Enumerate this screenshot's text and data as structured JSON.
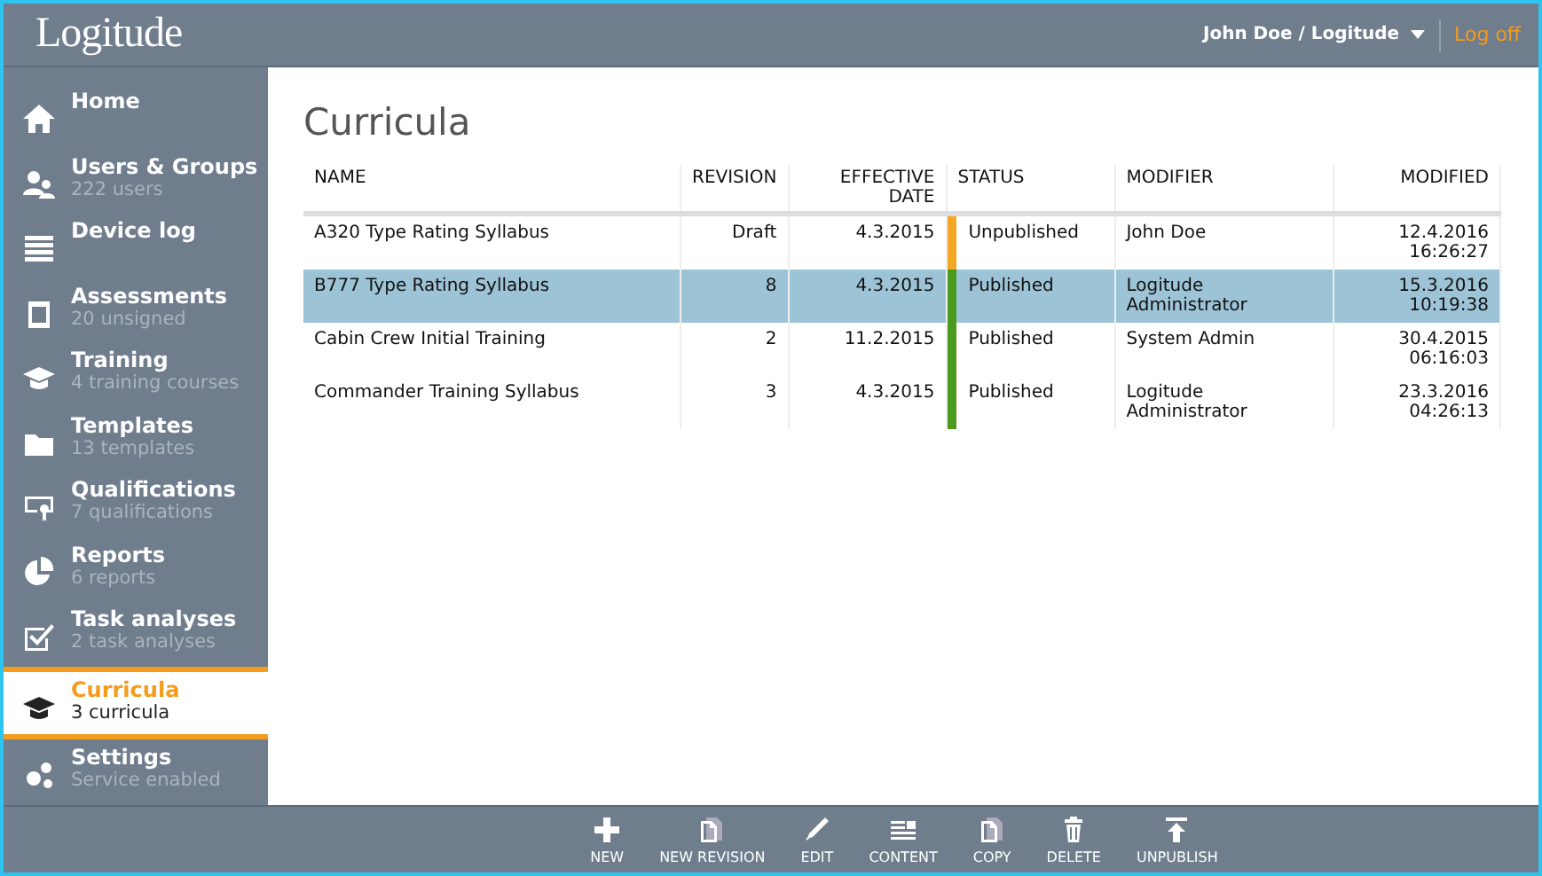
{
  "header": {
    "logo": "Logitude",
    "user": "John Doe / Logitude",
    "logoff": "Log off"
  },
  "sidebar": {
    "items": [
      {
        "label": "Home",
        "selected": false
      },
      {
        "label": "Users & Groups",
        "sub": "222 users",
        "selected": false
      },
      {
        "label": "Device log",
        "selected": false
      },
      {
        "label": "Assessments",
        "sub": "20 unsigned",
        "selected": false
      },
      {
        "label": "Training",
        "sub": "4 training courses",
        "selected": false
      },
      {
        "label": "Templates",
        "sub": "13 templates",
        "selected": false
      },
      {
        "label": "Qualifications",
        "sub": "7 qualifications",
        "selected": false
      },
      {
        "label": "Reports",
        "sub": "6 reports",
        "selected": false
      },
      {
        "label": "Task analyses",
        "sub": "2 task analyses",
        "selected": false
      },
      {
        "label": "Curricula",
        "sub": "3 curricula",
        "selected": true
      },
      {
        "label": "Settings",
        "sub": "Service enabled",
        "selected": false
      }
    ]
  },
  "page": {
    "title": "Curricula"
  },
  "table": {
    "columns": [
      "NAME",
      "REVISION",
      "EFFECTIVE DATE",
      "STATUS",
      "MODIFIER",
      "MODIFIED"
    ],
    "rows": [
      {
        "name": "A320 Type Rating Syllabus",
        "revision": "Draft",
        "effective": "4.3.2015",
        "status": "Unpublished",
        "color": "#f5a623",
        "modifier": "John Doe",
        "modified": [
          "12.4.2016",
          "16:26:27"
        ],
        "selected": false
      },
      {
        "name": "B777 Type Rating Syllabus",
        "revision": "8",
        "effective": "4.3.2015",
        "status": "Published",
        "color": "#4a9a1e",
        "modifier": "Logitude Administrator",
        "modified": [
          "15.3.2016",
          "10:19:38"
        ],
        "selected": true
      },
      {
        "name": "Cabin Crew Initial Training",
        "revision": "2",
        "effective": "11.2.2015",
        "status": "Published",
        "color": "#4a9a1e",
        "modifier": "System Admin",
        "modified": [
          "30.4.2015",
          "06:16:03"
        ],
        "selected": false
      },
      {
        "name": "Commander Training Syllabus",
        "revision": "3",
        "effective": "4.3.2015",
        "status": "Published",
        "color": "#4a9a1e",
        "modifier": "Logitude Administrator",
        "modified": [
          "23.3.2016",
          "04:26:13"
        ],
        "selected": false
      }
    ]
  },
  "toolbar": [
    "NEW",
    "NEW REVISION",
    "EDIT",
    "CONTENT",
    "COPY",
    "DELETE",
    "UNPUBLISH"
  ]
}
